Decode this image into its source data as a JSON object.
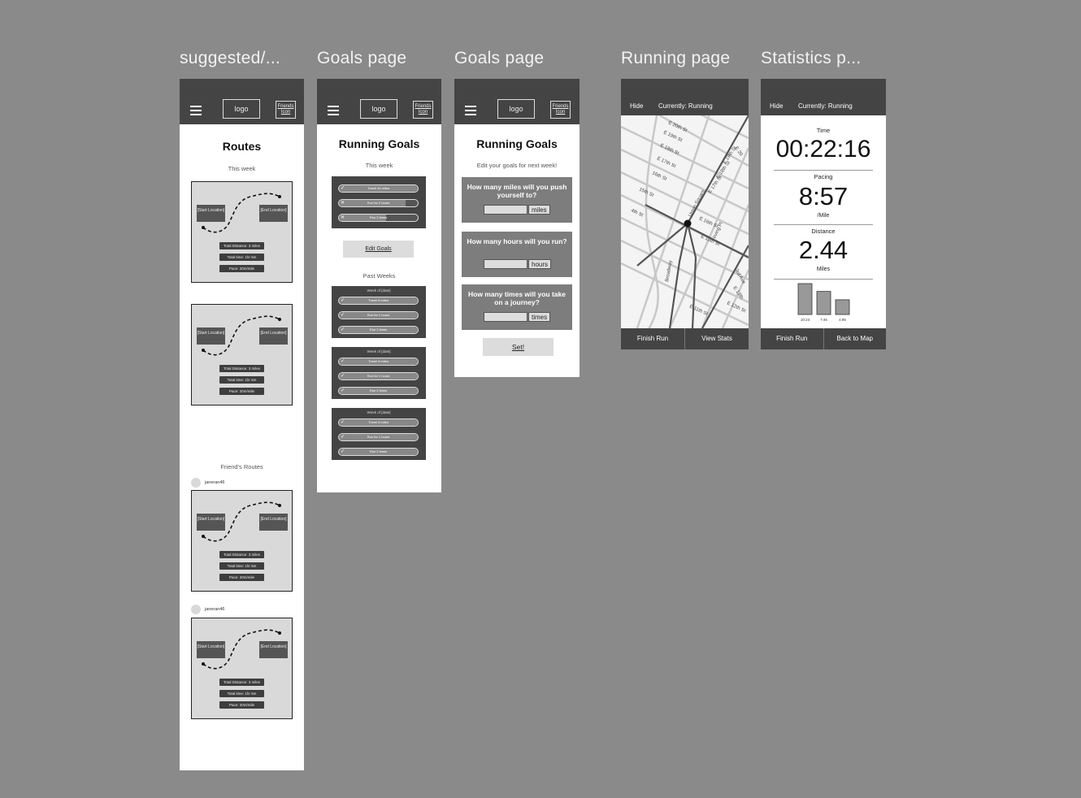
{
  "frames": {
    "routes": {
      "title": "suggested/...",
      "logo": "logo",
      "friends_icon": "Friends Icon",
      "page_title": "Routes",
      "section_this_week": "This week",
      "section_friends": "Friend's Routes"
    },
    "goals": {
      "title": "Goals page",
      "logo": "logo",
      "friends_icon": "Friends Icon",
      "page_title": "Running Goals",
      "section_this_week": "This week",
      "edit_button": "Edit Goals",
      "section_past": "Past Weeks"
    },
    "goals_edit": {
      "title": "Goals page",
      "logo": "logo",
      "friends_icon": "Friends Icon",
      "page_title": "Running Goals",
      "subtitle": "Edit your goals for next week!",
      "set_button": "Set!"
    },
    "running": {
      "title": "Running page",
      "hide": "Hide",
      "status": "Currently: Running",
      "finish": "Finish Run",
      "view_stats": "View Stats"
    },
    "stats": {
      "title": "Statistics p...",
      "hide": "Hide",
      "status": "Currently: Running",
      "finish": "Finish Run",
      "back": "Back to Map"
    }
  },
  "route_card": {
    "start": "[Start Location]",
    "end": "[End Location]",
    "distance": "Total Distance: 3 miles",
    "time": "Total time: 1hr 5m",
    "pace": "Pace: 20m/mile"
  },
  "friends": [
    {
      "username": "janeran46"
    },
    {
      "username": "janeran46"
    }
  ],
  "this_week_goals": [
    {
      "label": "Travel 10 miles",
      "status": "done",
      "progress": 1.0
    },
    {
      "label": "Run for 2 hours",
      "status": "missed",
      "progress": 0.85
    },
    {
      "label": "Run 3 times",
      "status": "missed",
      "progress": 0.6
    }
  ],
  "past_weeks": [
    {
      "week": "Week of [date]",
      "goals": [
        {
          "label": "Travel 8 miles",
          "status": "done"
        },
        {
          "label": "Run for 1 hours",
          "status": "done"
        },
        {
          "label": "Run 2 times",
          "status": "done"
        }
      ]
    },
    {
      "week": "Week of [date]",
      "goals": [
        {
          "label": "Travel 8 miles",
          "status": "done"
        },
        {
          "label": "Run for 1 hours",
          "status": "done"
        },
        {
          "label": "Run 2 times",
          "status": "done"
        }
      ]
    },
    {
      "week": "Week of [date]",
      "goals": [
        {
          "label": "Travel 8 miles",
          "status": "done"
        },
        {
          "label": "Run for 1 hours",
          "status": "done"
        },
        {
          "label": "Run 2 times",
          "status": "done"
        }
      ]
    }
  ],
  "goal_questions": [
    {
      "question": "How many miles will you push yourself to?",
      "unit": "miles"
    },
    {
      "question": "How many hours will you run?",
      "unit": "hours"
    },
    {
      "question": "How many times will you take on a journey?",
      "unit": "times"
    }
  ],
  "map_streets": [
    "E 20th St",
    "E 19th St",
    "E 18th St",
    "E 17th St",
    "16th St",
    "15th St",
    "4th St",
    "E 16th St",
    "E 15th St",
    "E 17th St",
    "E 18th St",
    "E 19th St",
    "E 20",
    "Broadway",
    "E 11th St",
    "E 12th St",
    "E 13th",
    "3rd Ave",
    "Irving Pl",
    "Union Square"
  ],
  "stats": {
    "time_label": "Time",
    "time": "00:22:16",
    "pacing_label": "Pacing",
    "pace": "8:57",
    "pace_unit": "/Mile",
    "distance_label": "Distance",
    "distance": "2.44",
    "distance_unit": "Miles",
    "splits": [
      {
        "label": "10:23",
        "value": 10.38
      },
      {
        "label": "7:45",
        "value": 7.75
      },
      {
        "label": "4:95",
        "value": 4.95
      }
    ]
  },
  "colors": {
    "canvas": "#8a8a8a",
    "header": "#444444",
    "card": "#d9d9d9"
  },
  "icons": [
    "hamburger-menu-icon",
    "check-icon",
    "x-icon",
    "map-pin-icon"
  ]
}
